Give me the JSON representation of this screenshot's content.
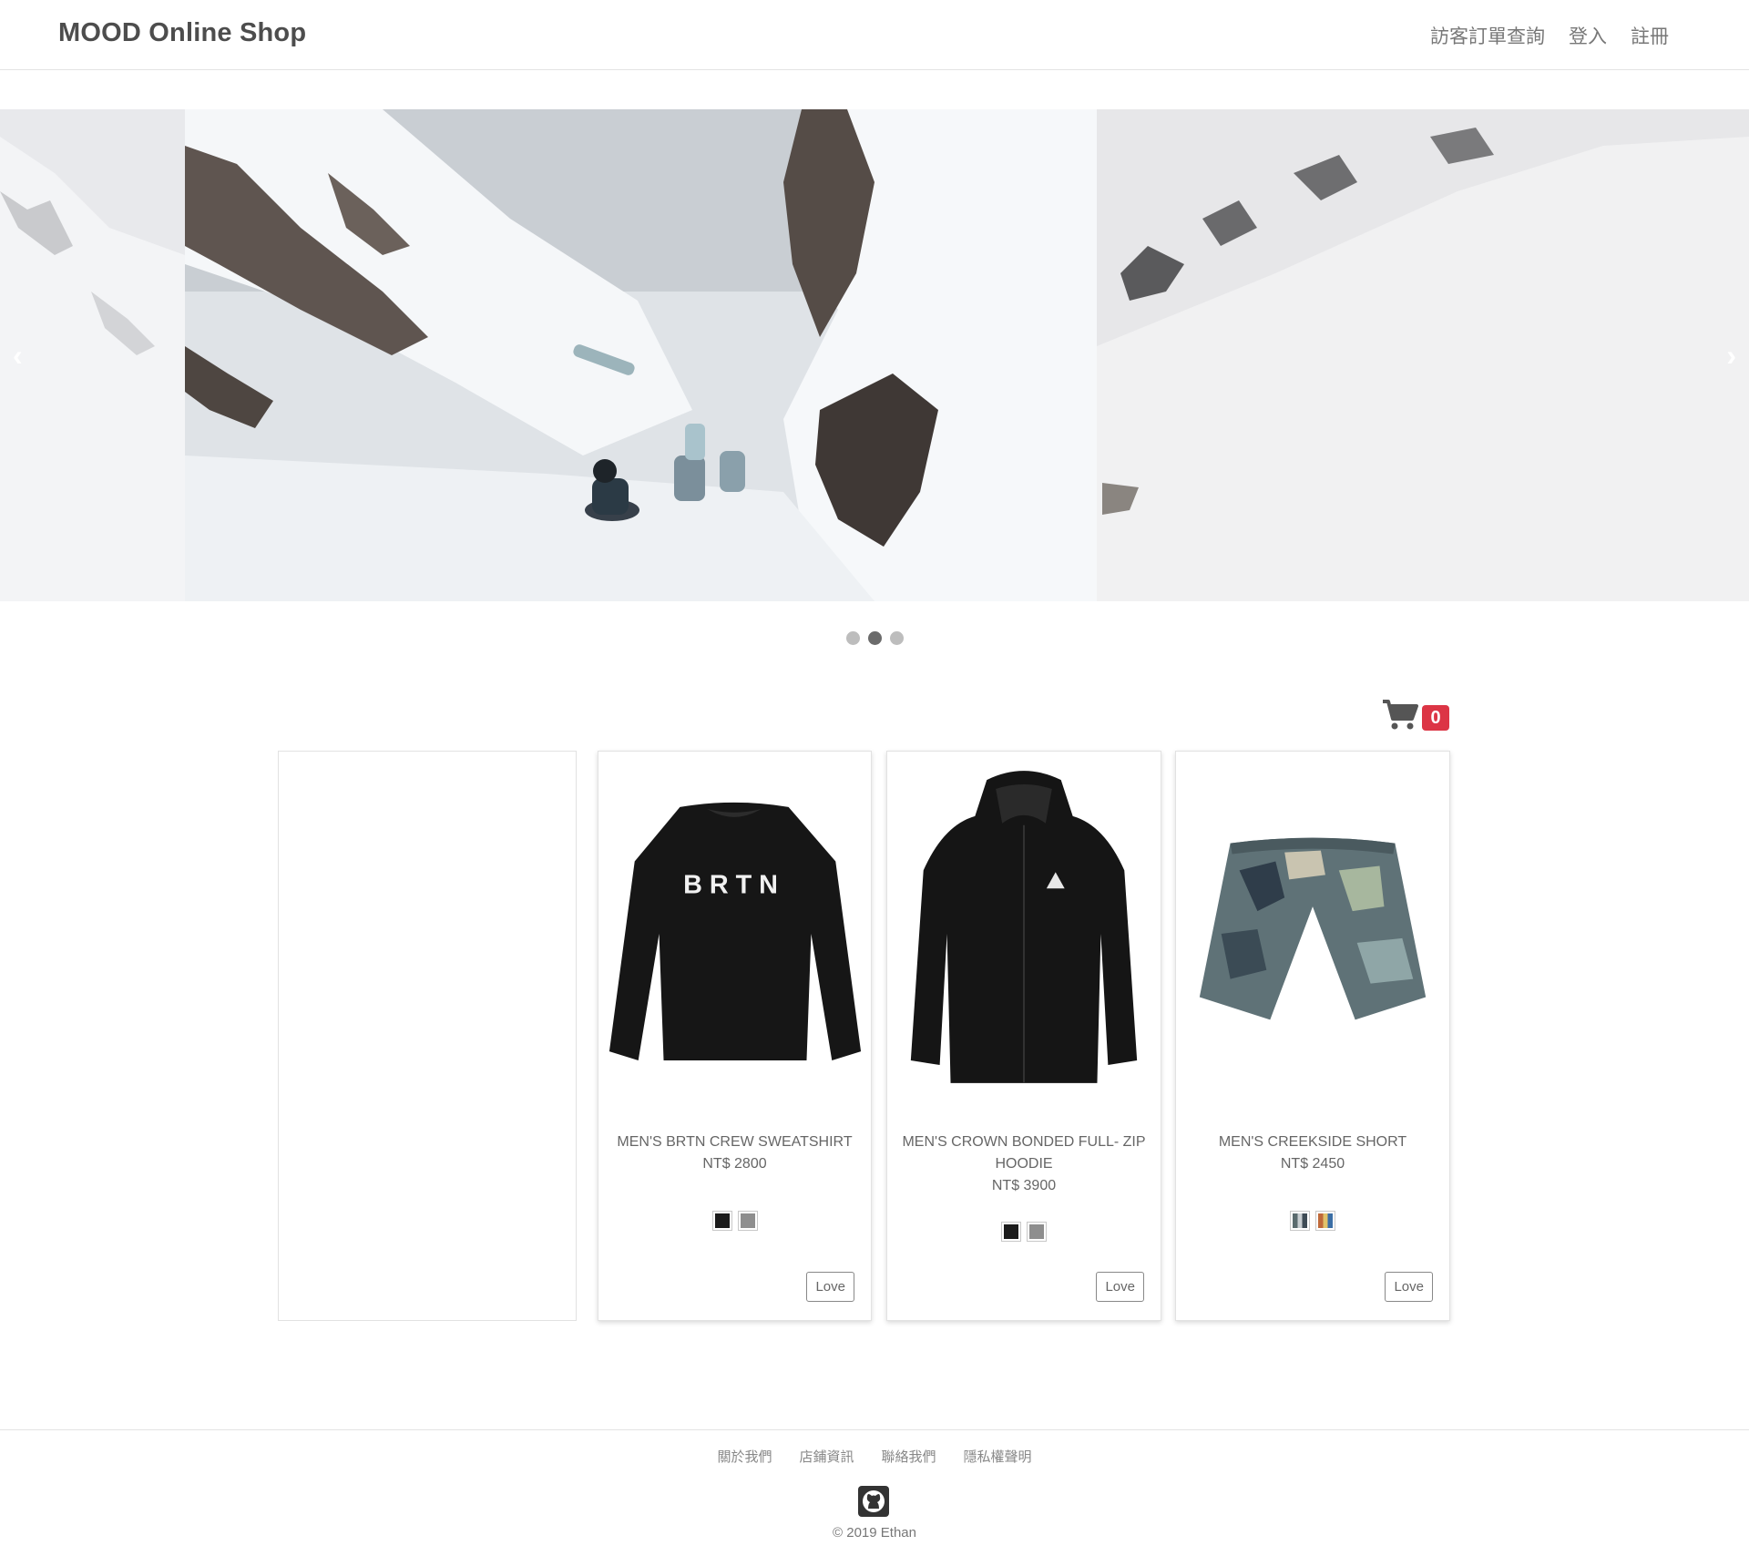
{
  "header": {
    "brand": "MOOD Online Shop",
    "nav": [
      {
        "label": "訪客訂單查詢"
      },
      {
        "label": "登入"
      },
      {
        "label": "註冊"
      }
    ]
  },
  "carousel": {
    "prev_icon": "chevron-left-icon",
    "next_icon": "chevron-right-icon",
    "prev_glyph": "‹",
    "next_glyph": "›",
    "slide_count": 3,
    "active_index": 1
  },
  "cart": {
    "icon": "shopping-cart-icon",
    "count": "0",
    "badge_color": "#dc3545"
  },
  "products": [
    {
      "name": "MEN'S BRTN CREW SWEATSHIRT",
      "price": "NT$ 2800",
      "colors": [
        "#1b1b1b",
        "#8e8e8e"
      ],
      "love_label": "Love"
    },
    {
      "name": "MEN'S CROWN BONDED FULL- ZIP HOODIE",
      "price": "NT$ 3900",
      "colors": [
        "#1b1b1b",
        "#8e8e8e"
      ],
      "love_label": "Love"
    },
    {
      "name": "MEN'S CREEKSIDE SHORT",
      "price": "NT$ 2450",
      "colors": [
        "#5a6b6e",
        "#c06a3a"
      ],
      "love_label": "Love"
    }
  ],
  "print_text": "BRTN",
  "footer": {
    "links": [
      {
        "label": "關於我們"
      },
      {
        "label": "店鋪資訊"
      },
      {
        "label": "聯絡我們"
      },
      {
        "label": "隱私權聲明"
      }
    ],
    "github_icon": "github-icon",
    "copyright": "© 2019 Ethan"
  }
}
